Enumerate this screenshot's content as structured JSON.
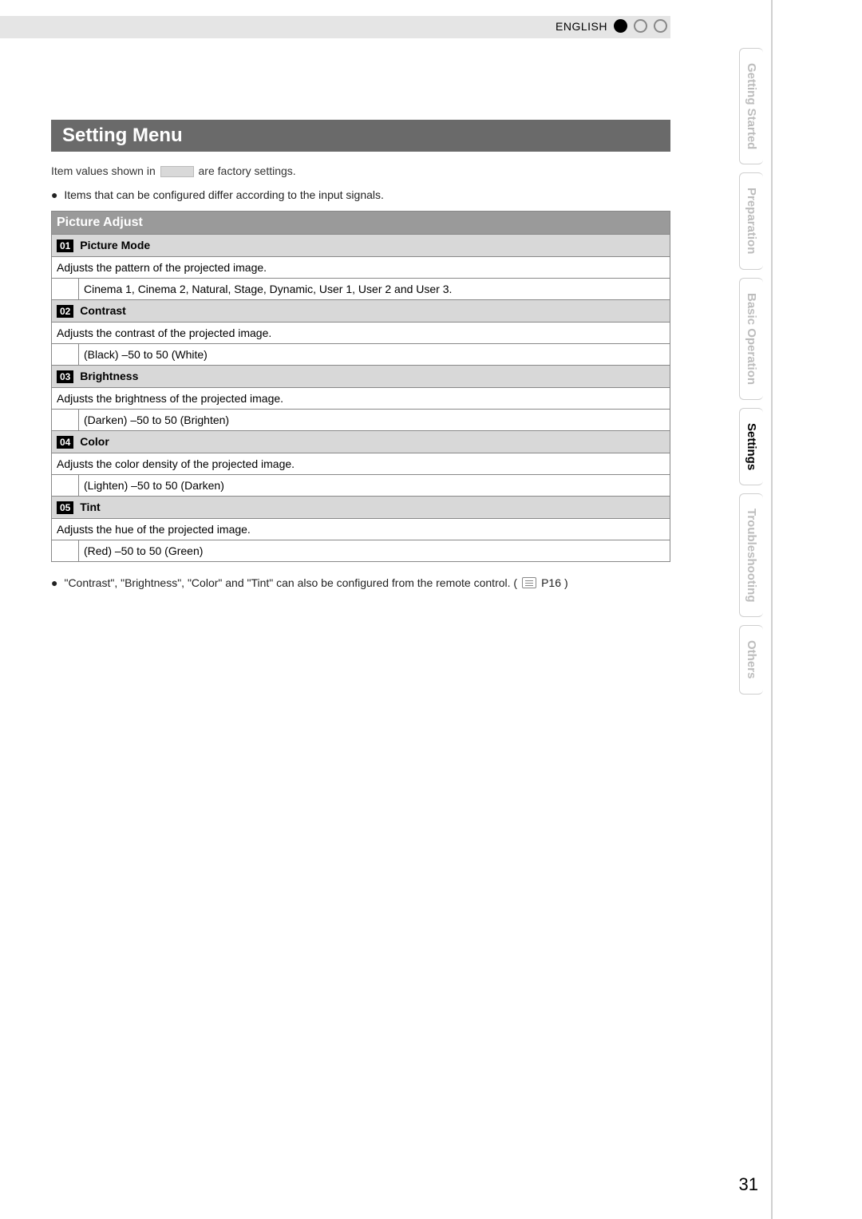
{
  "header": {
    "language": "ENGLISH"
  },
  "tabs": {
    "t1": "Getting Started",
    "t2": "Preparation",
    "t3": "Basic Operation",
    "t4": "Settings",
    "t5": "Troubleshooting",
    "t6": "Others"
  },
  "title": "Setting Menu",
  "intro": {
    "part1a": "Item values shown in ",
    "part1b": " are factory settings.",
    "part2": "Items that can be configured differ according to the input signals."
  },
  "section": {
    "picture_adjust": "Picture Adjust"
  },
  "items": {
    "i01": {
      "num": "01",
      "name": "Picture Mode",
      "desc": "Adjusts the pattern of the projected image.",
      "range": "Cinema 1, Cinema 2, Natural, Stage, Dynamic, User 1, User 2 and User 3."
    },
    "i02": {
      "num": "02",
      "name": "Contrast",
      "desc": "Adjusts the contrast of the projected image.",
      "range": "(Black) –50 to 50 (White)"
    },
    "i03": {
      "num": "03",
      "name": "Brightness",
      "desc": "Adjusts the brightness of the projected image.",
      "range": "(Darken) –50 to 50 (Brighten)"
    },
    "i04": {
      "num": "04",
      "name": "Color",
      "desc": "Adjusts the color density of the projected image.",
      "range": "(Lighten) –50 to 50 (Darken)"
    },
    "i05": {
      "num": "05",
      "name": "Tint",
      "desc": "Adjusts the hue of the projected image.",
      "range": "(Red) –50 to 50 (Green)"
    }
  },
  "footnote": {
    "text_a": "\"Contrast\", \"Brightness\", \"Color\" and \"Tint\" can also be configured from the remote control. (",
    "ref": "P16",
    "text_b": ")"
  },
  "page_number": "31"
}
